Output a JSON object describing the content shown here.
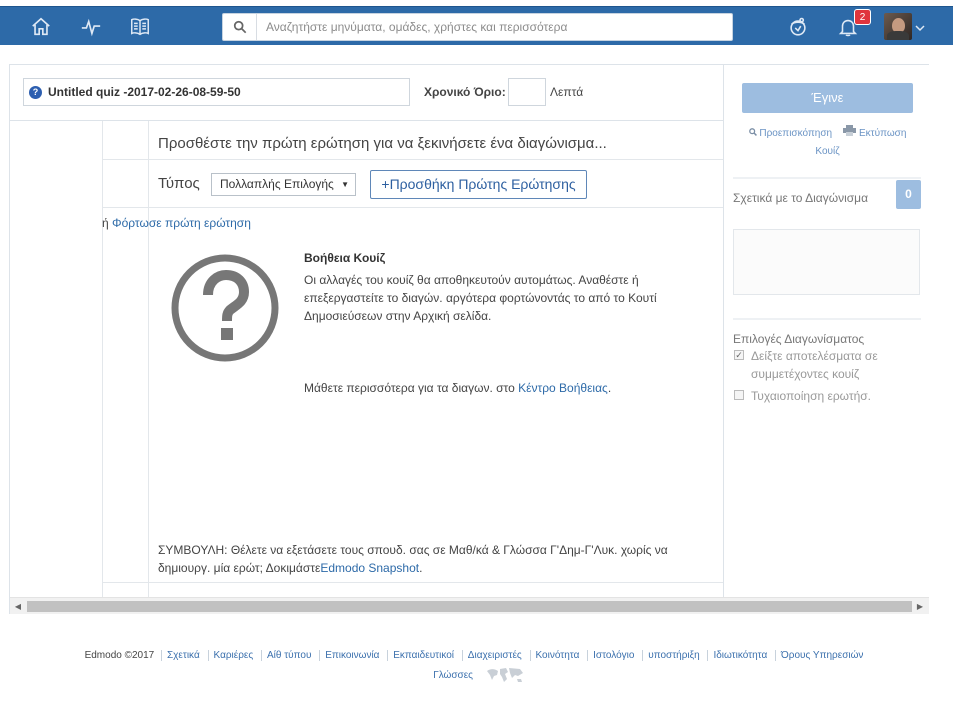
{
  "nav": {
    "search_placeholder": "Αναζητήστε μηνύματα, ομάδες, χρήστες και περισσότερα",
    "notification_count": "2"
  },
  "quiz": {
    "title": "Untitled quiz -2017-02-26-08-59-50",
    "time_limit_label": "Χρονικό Όριο:",
    "time_limit_value": "",
    "time_unit": "Λεπτά",
    "prompt": "Προσθέστε την πρώτη ερώτηση για να ξεκινήσετε ένα διαγώνισμα...",
    "type_label": "Τύπος",
    "type_selected": "Πολλαπλής Επιλογής",
    "add_first_question": "+Προσθήκη Πρώτης Ερώτησης",
    "upload_prefix": "ή",
    "upload_link": "Φόρτωσε πρώτη ερώτηση",
    "help_title": "Βοήθεια Κουίζ",
    "help_text": "Οι αλλαγές του κουίζ θα αποθηκευτούν αυτομάτως. Αναθέστε ή επεξεργαστείτε το διαγών. αργότερα φορτώνοντάς το από το Κουτί Δημοσιεύσεων στην Αρχική σελίδα.",
    "learn_more_text": "Μάθετε περισσότερα για τα διαγων. στο",
    "learn_more_link": "Κέντρο Βοήθειας",
    "learn_more_end": ".",
    "tip_text": "ΣΥΜΒΟΥΛΗ: Θέλετε να εξετάσετε τους σπουδ. σας σε Μαθ/κά & Γλώσσα Γ'Δημ-Γ'Λυκ. χωρίς να δημιουργ. μία ερώτ; Δοκιμάστε",
    "tip_link": "Edmodo Snapshot",
    "tip_end": "."
  },
  "sidebar": {
    "done_button": "Έγινε",
    "preview_link": "Προεπισκόπηση",
    "print_link": "Εκτύπωση",
    "print_link_2": "Κουίζ",
    "about_title": "Σχετικά με το Διαγώνισμα",
    "about_count": "0",
    "about_text": "",
    "options_title": "Επιλογές Διαγωνίσματος",
    "options": [
      {
        "label": "Δείξτε αποτελέσματα σε συμμετέχοντες κουίζ",
        "checked": true
      },
      {
        "label": "Τυχαιοποίηση ερωτήσ.",
        "checked": false
      }
    ]
  },
  "footer": {
    "copyright": "Edmodo ©2017",
    "links": [
      "Σχετικά",
      "Καριέρες",
      "Αίθ τύπου",
      "Επικοινωνία",
      "Εκπαιδευτικοί",
      "Διαχειριστές",
      "Κοινότητα",
      "Ιστολόγιο",
      "υποστήριξη",
      "Ιδιωτικότητα",
      "Όρους Υπηρεσιών"
    ],
    "languages": "Γλώσσες"
  }
}
